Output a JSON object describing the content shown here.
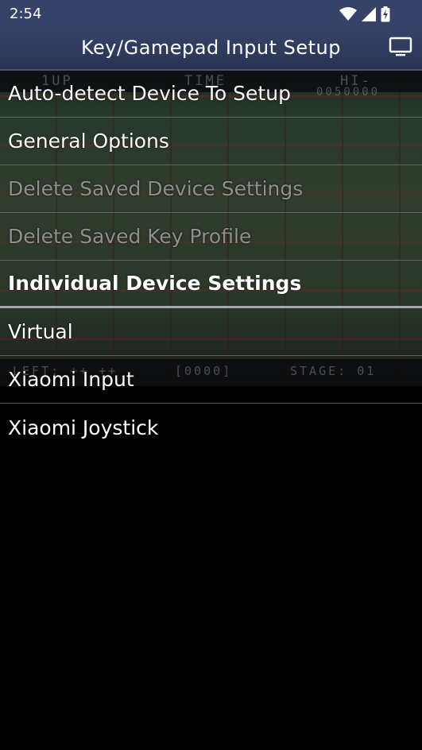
{
  "status_bar": {
    "time": "2:54",
    "icons": [
      "wifi-icon",
      "cell-signal-icon",
      "battery-charging-icon"
    ]
  },
  "action_bar": {
    "title": "Key/Gamepad Input Setup",
    "screen_button_icon": "monitor-icon"
  },
  "background": {
    "hud_top": [
      "1UP",
      "TIME",
      "HI-",
      "0050000"
    ],
    "hud_bottom": [
      "LEFT: ++ ++",
      "[0000]",
      "STAGE: 01"
    ]
  },
  "menu": {
    "items": [
      {
        "label": "Auto-detect Device To Setup",
        "state": "enabled"
      },
      {
        "label": "General Options",
        "state": "enabled"
      },
      {
        "label": "Delete Saved Device Settings",
        "state": "disabled"
      },
      {
        "label": "Delete Saved Key Profile",
        "state": "disabled"
      },
      {
        "label": "Individual Device Settings",
        "state": "header"
      },
      {
        "label": "Virtual",
        "state": "enabled"
      },
      {
        "label": "Xiaomi Input",
        "state": "enabled"
      },
      {
        "label": "Xiaomi Joystick",
        "state": "enabled"
      }
    ]
  },
  "colors": {
    "status_bar": "#364268",
    "background": "#000000",
    "disabled_text": "#8f8f8f",
    "text": "#ffffff"
  }
}
